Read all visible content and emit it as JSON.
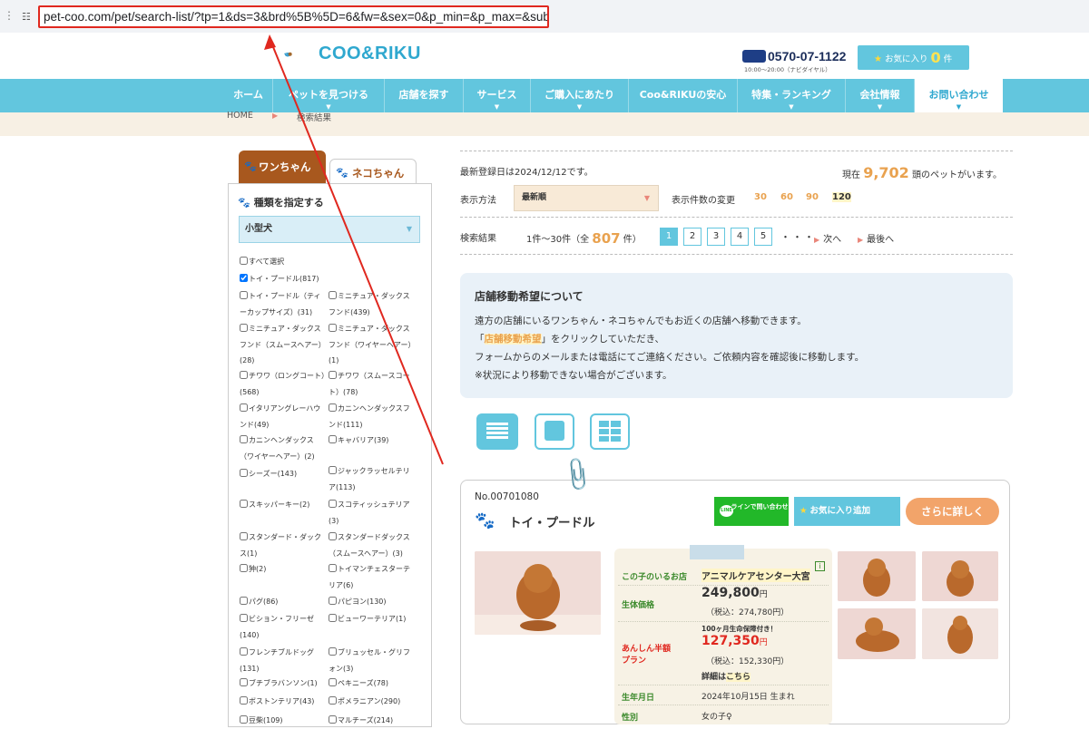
{
  "browser": {
    "url": "pet-coo.com/pet/search-list/?tp=1&ds=3&brd%5B%5D=6&fw=&sex=0&p_min=&p_max=&submit="
  },
  "header": {
    "logo_text": "COO&RIKU",
    "phone": "0570-07-1122",
    "phone_sub": "10:00〜20:00（ナビダイヤル）",
    "favorites_label": "お気に入り",
    "favorites_count": "0",
    "favorites_unit": "件"
  },
  "nav": {
    "items": [
      "ホーム",
      "ペットを見つける",
      "店舗を探す",
      "サービス",
      "ご購入にあたり",
      "Coo&RIKUの安心",
      "特集・ランキング",
      "会社情報",
      "お問い合わせ"
    ]
  },
  "breadcrumb": {
    "home": "HOME",
    "current": "検索結果"
  },
  "sidebar": {
    "tab_dog": "ワンちゃん",
    "tab_cat": "ネコちゃん",
    "heading": "種類を指定する",
    "size_select": "小型犬",
    "select_all": "すべて選択",
    "breeds_left": [
      {
        "label": "トイ・プードル(817)",
        "checked": true
      },
      {
        "label": "トイ・プードル（ティーカップサイズ）(31)",
        "checked": false
      },
      {
        "label": "ミニチュア・ダックスフンド（スムースヘアー）(28)",
        "checked": false
      },
      {
        "label": "チワワ（ロングコート）(568)",
        "checked": false
      },
      {
        "label": "イタリアングレーハウンド(49)",
        "checked": false
      },
      {
        "label": "カニンヘンダックス（ワイヤーヘアー）(2)",
        "checked": false
      },
      {
        "label": "シーズー(143)",
        "checked": false
      },
      {
        "label": "スキッパーキー(2)",
        "checked": false
      },
      {
        "label": "スタンダード・ダックス(1)",
        "checked": false
      },
      {
        "label": "狆(2)",
        "checked": false
      },
      {
        "label": "パグ(86)",
        "checked": false
      },
      {
        "label": "ビション・フリーゼ(140)",
        "checked": false
      },
      {
        "label": "フレンチブルドッグ(131)",
        "checked": false
      },
      {
        "label": "ブチブラバンソン(1)",
        "checked": false
      },
      {
        "label": "ボストンテリア(43)",
        "checked": false
      },
      {
        "label": "豆柴(109)",
        "checked": false
      }
    ],
    "breeds_right": [
      {
        "label": "ミニチュア・ダックスフンド(439)",
        "checked": false
      },
      {
        "label": "ミニチュア・ダックスフンド（ワイヤーヘアー）(1)",
        "checked": false
      },
      {
        "label": "チワワ（スムースコート）(78)",
        "checked": false
      },
      {
        "label": "カニンヘンダックスフンド(111)",
        "checked": false
      },
      {
        "label": "キャバリア(39)",
        "checked": false
      },
      {
        "label": "ジャックラッセルテリア(113)",
        "checked": false
      },
      {
        "label": "スコティッシュテリア(3)",
        "checked": false
      },
      {
        "label": "スタンダードダックス（スムースヘアー）(3)",
        "checked": false
      },
      {
        "label": "トイマンチェスターテリア(6)",
        "checked": false
      },
      {
        "label": "パピヨン(130)",
        "checked": false
      },
      {
        "label": "ビューワーテリア(1)",
        "checked": false
      },
      {
        "label": "ブリュッセル・グリフォン(3)",
        "checked": false
      },
      {
        "label": "ペキニーズ(78)",
        "checked": false
      },
      {
        "label": "ポメラニアン(290)",
        "checked": false
      },
      {
        "label": "マルチーズ(214)",
        "checked": false
      }
    ]
  },
  "main": {
    "registered": "最新登録日は2024/12/12です。",
    "count_prefix": "現在",
    "count_value": "9,702",
    "count_suffix": "頭のペットがいます。",
    "sort_label": "表示方法",
    "sort_value": "最新順",
    "perpage_label": "表示件数の変更",
    "perpage": [
      "30",
      "60",
      "90",
      "120"
    ],
    "results_label": "検索結果",
    "results_range_a": "1件〜30件（全",
    "results_total": "807",
    "results_range_b": "件）",
    "pages": [
      "1",
      "2",
      "3",
      "4",
      "5"
    ],
    "dots": "・・・",
    "next": "次へ",
    "last": "最後へ"
  },
  "info": {
    "title": "店舗移動希望について",
    "line1": "遠方の店舗にいるワンちゃん・ネコちゃんでもお近くの店舗へ移動できます。",
    "line2a": "「",
    "line2_hl": "店舗移動希望",
    "line2b": "」をクリックしていただき、",
    "line3": "フォームからのメールまたは電話にてご連絡ください。ご依頼内容を確認後に移動します。",
    "line4": "※状況により移動できない場合がございます。"
  },
  "card": {
    "pet_no": "No.00701080",
    "breed": "トイ・プードル",
    "line_btn": "ラインで問い合わせ",
    "fav_btn": "お気に入り追加",
    "more_btn": "さらに詳しく",
    "shop_label": "この子のいるお店",
    "shop_value": "アニマルケアセンター大宮",
    "price_label": "生体価格",
    "price_value": "249,800",
    "price_unit": "円",
    "price_tax": "（税込：274,780円）",
    "guarantee_note": "100ヶ月生命保障付き！",
    "anshin_label_1": "あんしん半額",
    "anshin_label_2": "プラン",
    "anshin_value": "127,350",
    "anshin_unit": "円",
    "anshin_tax": "（税込：152,330円）",
    "details": "詳細は",
    "details_link": "こちら",
    "birth_label": "生年月日",
    "birth_value": "2024年10月15日 生まれ",
    "sex_label": "性別",
    "sex_value": "女の子♀"
  },
  "colors": {
    "accent": "#62c6de",
    "brand_brown": "#a8581e",
    "orange": "#e9a24f",
    "annotation_red": "#e0281f"
  }
}
